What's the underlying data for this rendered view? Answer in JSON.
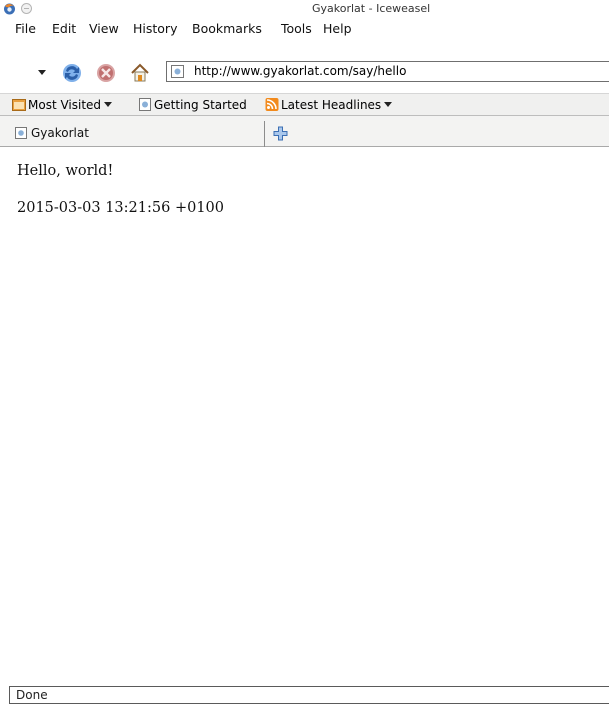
{
  "window": {
    "title": "Gyakorlat - Iceweasel"
  },
  "menu": {
    "items": [
      {
        "label": "File"
      },
      {
        "label": "Edit"
      },
      {
        "label": "View"
      },
      {
        "label": "History"
      },
      {
        "label": "Bookmarks"
      },
      {
        "label": "Tools"
      },
      {
        "label": "Help"
      }
    ]
  },
  "navigation": {
    "url": "http://www.gyakorlat.com/say/hello",
    "icons": [
      "back-dropdown-marker",
      "reload-icon",
      "stop-icon",
      "home-icon",
      "site-favicon"
    ]
  },
  "bookmarks": {
    "items": [
      {
        "label": "Most Visited",
        "icon": "most-visited-icon",
        "has_dropdown": true
      },
      {
        "label": "Getting Started",
        "icon": "page-icon",
        "has_dropdown": false
      },
      {
        "label": "Latest Headlines",
        "icon": "rss-icon",
        "has_dropdown": true
      }
    ]
  },
  "tabs": [
    {
      "label": "Gyakorlat",
      "icon": "page-icon"
    }
  ],
  "page": {
    "lines": [
      "Hello, world!",
      "2015-03-03 13:21:56 +0100"
    ]
  },
  "status": {
    "text": "Done"
  },
  "colors": {
    "rss": "#f28a1c",
    "stop": "#c0392b",
    "reload": "#3f7fd0"
  }
}
